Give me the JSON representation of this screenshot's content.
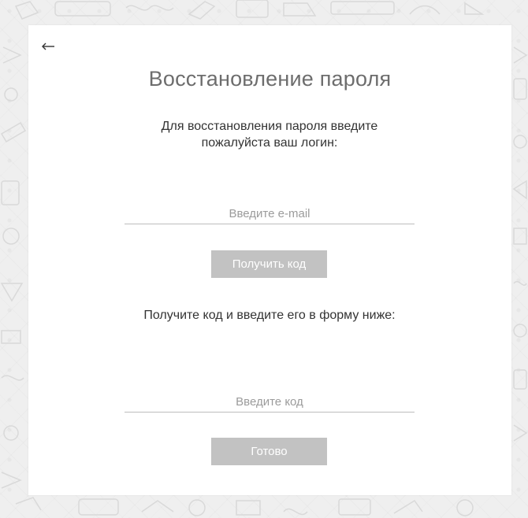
{
  "form": {
    "back_icon": "arrow-left-icon",
    "title": "Восстановление пароля",
    "instruction_login": "Для восстановления пароля введите пожалуйста ваш логин:",
    "email_placeholder": "Введите e-mail",
    "email_value": "",
    "get_code_label": "Получить код",
    "instruction_code": "Получите код и введите его в форму ниже:",
    "code_placeholder": "Введите код",
    "code_value": "",
    "done_label": "Готово"
  },
  "colors": {
    "background": "#efefef",
    "card": "#ffffff",
    "button": "#c2c2c2",
    "title_text": "#6d6d6d",
    "body_text": "#333333"
  }
}
